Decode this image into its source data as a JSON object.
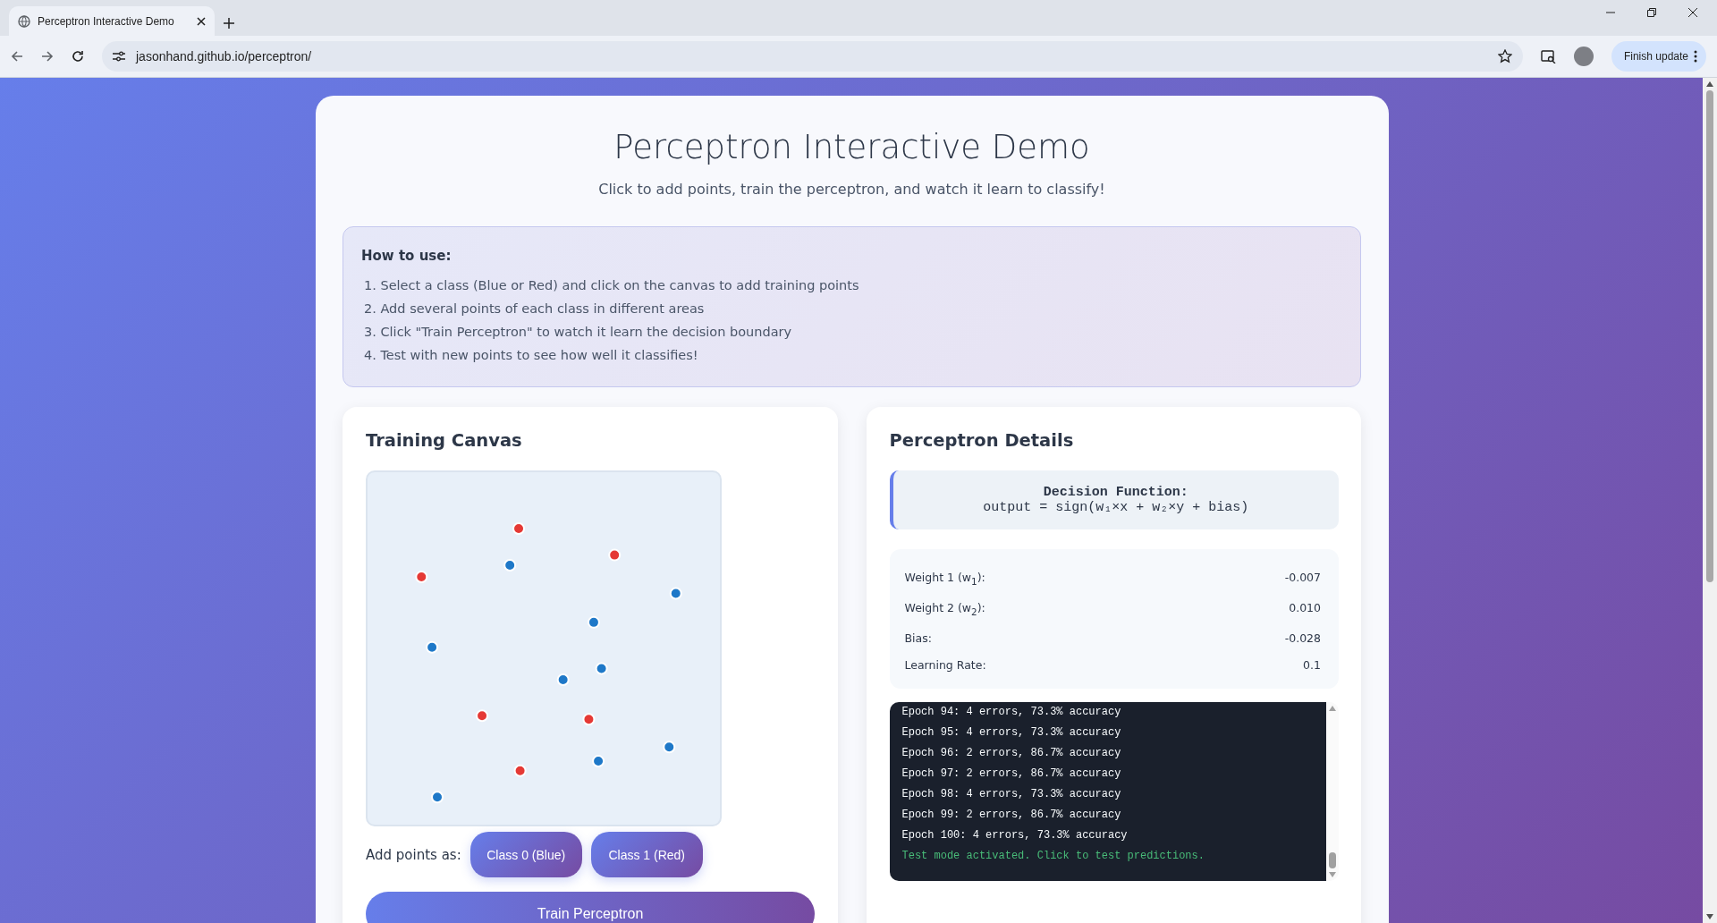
{
  "browser": {
    "tab_title": "Perceptron Interactive Demo",
    "url": "jasonhand.github.io/perceptron/",
    "update_button": "Finish update"
  },
  "page": {
    "title": "Perceptron Interactive Demo",
    "subtitle": "Click to add points, train the perceptron, and watch it learn to classify!"
  },
  "instructions": {
    "heading": "How to use:",
    "steps": [
      "1. Select a class (Blue or Red) and click on the canvas to add training points",
      "2. Add several points of each class in different areas",
      "3. Click \"Train Perceptron\" to watch it learn the decision boundary",
      "4. Test with new points to see how well it classifies!"
    ]
  },
  "training": {
    "title": "Training Canvas",
    "add_label": "Add points as:",
    "class_buttons": [
      "Class 0 (Blue)",
      "Class 1 (Red)"
    ],
    "train_button": "Train Perceptron"
  },
  "details": {
    "title": "Perceptron Details",
    "function_title": "Decision Function:",
    "function": "output = sign(w₁×x + w₂×y + bias)",
    "parameters": [
      {
        "label": "Weight 1 (w$_{1}$):",
        "value": "-0.007"
      },
      {
        "label": "Weight 2 (w$_{2}$):",
        "value": "0.010"
      },
      {
        "label": "Bias:",
        "value": "-0.028"
      },
      {
        "label": "Learning Rate:",
        "value": "0.1"
      }
    ],
    "log": [
      {
        "kind": "epoch",
        "text": "Epoch 94: 4 errors, 73.3% accuracy"
      },
      {
        "kind": "epoch",
        "text": "Epoch 95: 4 errors, 73.3% accuracy"
      },
      {
        "kind": "epoch",
        "text": "Epoch 96: 2 errors, 86.7% accuracy"
      },
      {
        "kind": "epoch",
        "text": "Epoch 97: 2 errors, 86.7% accuracy"
      },
      {
        "kind": "epoch",
        "text": "Epoch 98: 4 errors, 73.3% accuracy"
      },
      {
        "kind": "epoch",
        "text": "Epoch 99: 2 errors, 86.7% accuracy"
      },
      {
        "kind": "epoch",
        "text": "Epoch 100: 4 errors, 73.3% accuracy"
      },
      {
        "kind": "info",
        "text": "Test mode activated. Click to test predictions."
      }
    ]
  }
}
